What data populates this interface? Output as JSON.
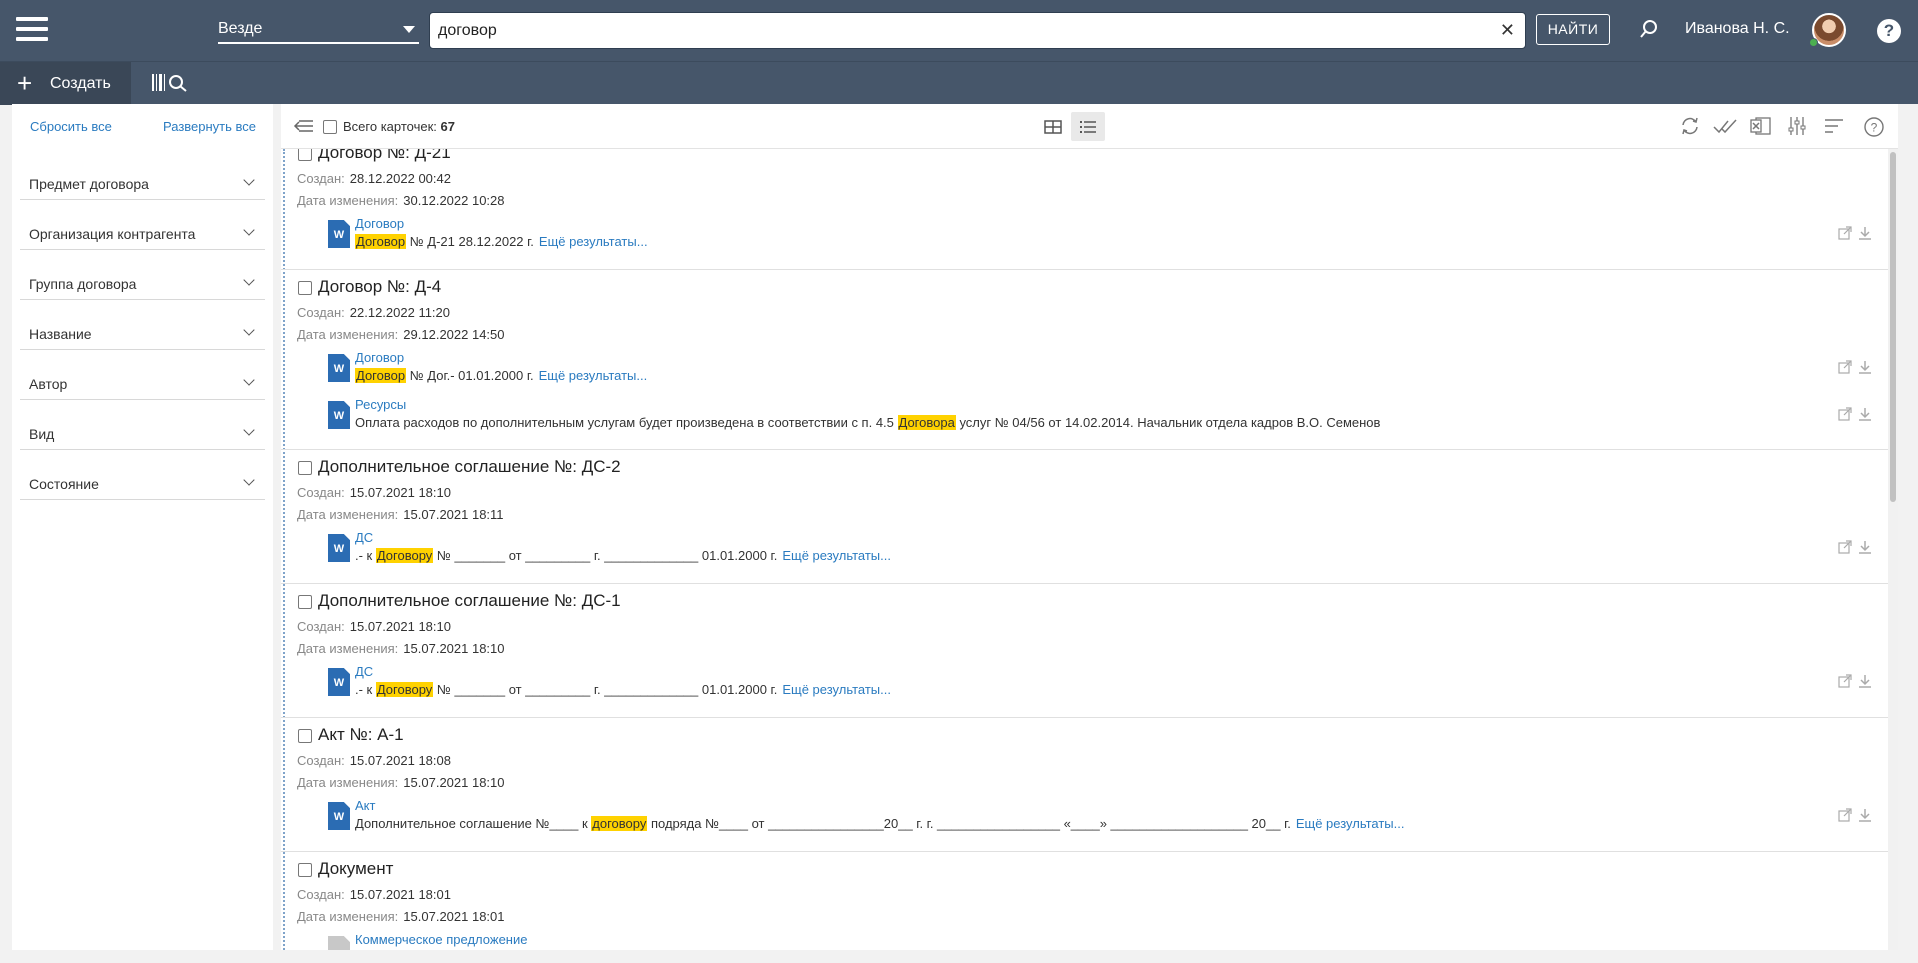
{
  "header": {
    "scope_selected": "Везде",
    "search_value": "договор",
    "clear_symbol": "✕",
    "find_label": "НАЙТИ",
    "user_name": "Иванова Н. С.",
    "help_symbol": "?",
    "colors": {
      "bar": "#46566a",
      "accent": "#2a7bc0",
      "highlight": "#ffd200"
    }
  },
  "toolbar": {
    "create_label": "Создать"
  },
  "filters": {
    "reset_label": "Сбросить все",
    "expand_label": "Развернуть все",
    "facets": [
      "Предмет договора",
      "Организация контрагента",
      "Группа договора",
      "Название",
      "Автор",
      "Вид",
      "Состояние"
    ]
  },
  "results": {
    "total_label": "Всего карточек:",
    "total_count": "67",
    "created_label": "Создан:",
    "modified_label": "Дата изменения:",
    "more_label": "Ещё результаты...",
    "cards": [
      {
        "title": "Договор №: Д-21",
        "created": "28.12.2022 00:42",
        "modified": "30.12.2022 10:28",
        "files": [
          {
            "name": "Договор",
            "pre": "",
            "hl": "Договор",
            "post": " № Д-21 28.12.2022 г.",
            "more": true
          }
        ]
      },
      {
        "title": "Договор №: Д-4",
        "created": "22.12.2022 11:20",
        "modified": "29.12.2022 14:50",
        "files": [
          {
            "name": "Договор",
            "pre": "",
            "hl": "Договор",
            "post": " № Дог.- 01.01.2000 г.",
            "more": true
          },
          {
            "name": "Ресурсы",
            "pre": "Оплата расходов по дополнительным услугам будет произведена в соответствии с п. 4.5 ",
            "hl": "Договора",
            "post": " услуг № 04/56 от 14.02.2014.      Начальник отдела кадров           В.О. Семенов",
            "more": false
          }
        ]
      },
      {
        "title": "Дополнительное соглашение №: ДС-2",
        "created": "15.07.2021 18:10",
        "modified": "15.07.2021 18:11",
        "files": [
          {
            "name": "ДС",
            "pre": ".- к ",
            "hl": "Договору",
            "post": " № _______ от _________ г. _____________ 01.01.2000 г.",
            "more": true
          }
        ]
      },
      {
        "title": "Дополнительное соглашение №: ДС-1",
        "created": "15.07.2021 18:10",
        "modified": "15.07.2021 18:10",
        "files": [
          {
            "name": "ДС",
            "pre": ".- к ",
            "hl": "Договору",
            "post": " № _______ от _________ г. _____________ 01.01.2000 г.",
            "more": true
          }
        ]
      },
      {
        "title": "Акт №: А-1",
        "created": "15.07.2021 18:08",
        "modified": "15.07.2021 18:10",
        "files": [
          {
            "name": "Акт",
            "pre": "Дополнительное соглашение №____ к ",
            "hl": "договору",
            "post": " подряда №____ от ________________20__ г. г. _________________ «____» ___________________ 20__ г.",
            "more": true
          }
        ]
      },
      {
        "title": "Документ",
        "created": "15.07.2021 18:01",
        "modified": "15.07.2021 18:01",
        "files": [
          {
            "name": "Коммерческое предложение",
            "pre": "",
            "hl": "",
            "post": "",
            "more": false
          }
        ]
      }
    ]
  }
}
